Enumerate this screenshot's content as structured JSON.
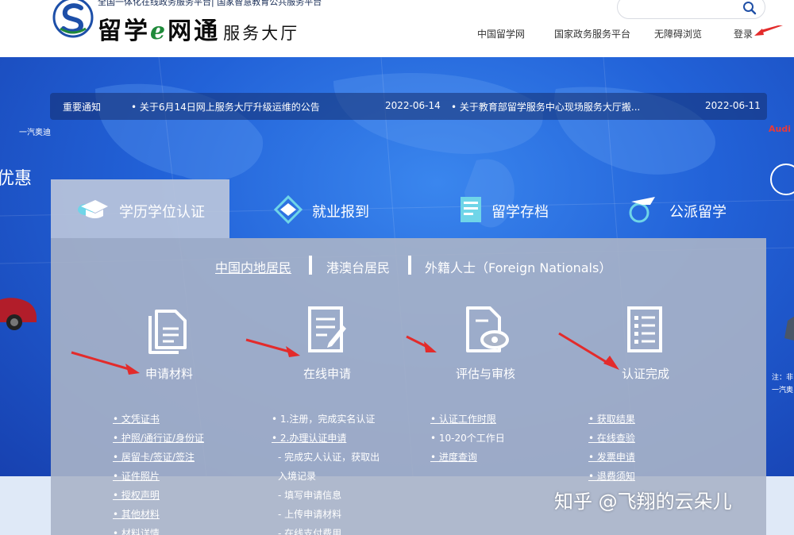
{
  "header": {
    "logo_top": "全国一体化在线政务服务平台| 国家智慧教育公共服务平台",
    "logo_brand": "留学e网通",
    "logo_sub": "服务大厅",
    "search_placeholder": "",
    "links": [
      "中国留学网",
      "国家政务服务平台",
      "无障碍浏览",
      "登录"
    ]
  },
  "notice": {
    "label": "重要通知",
    "items": [
      {
        "title": "• 关于6月14日网上服务大厅升级运维的公告",
        "date": "2022-06-14"
      },
      {
        "title": "• 关于教育部留学服务中心现场服务大厅搬...",
        "date": "2022-06-11"
      }
    ]
  },
  "banner_side": {
    "left_small": "一汽奥迪",
    "left_big": "优惠",
    "right_red": "Audi",
    "right_note_1": "注：非",
    "right_note_2": "一汽奥"
  },
  "tabs": [
    {
      "label": "学历学位认证",
      "icon": "graduation-cap-icon"
    },
    {
      "label": "就业报到",
      "icon": "handshake-icon"
    },
    {
      "label": "留学存档",
      "icon": "archive-icon"
    },
    {
      "label": "公派留学",
      "icon": "plane-globe-icon"
    }
  ],
  "citizen": [
    "中国内地居民",
    "港澳台居民",
    "外籍人士（Foreign Nationals）"
  ],
  "steps": [
    {
      "label": "申请材料",
      "icon": "documents-icon",
      "items": [
        "• 文凭证书",
        "• 护照/通行证/身份证",
        "• 居留卡/签证/签注",
        "• 证件照片",
        "• 授权声明",
        "• 其他材料",
        "• 材料详情"
      ]
    },
    {
      "label": "在线申请",
      "icon": "form-edit-icon",
      "items": [
        "• 1.注册，完成实名认证",
        "• 2.办理认证申请",
        "  - 完成实人认证，获取出",
        "入境记录",
        "  - 填写申请信息",
        "  - 上传申请材料",
        "  - 在线支付费用"
      ]
    },
    {
      "label": "评估与审核",
      "icon": "document-eye-icon",
      "items": [
        "• 认证工作时限",
        "• 10-20个工作日",
        "• 进度查询"
      ]
    },
    {
      "label": "认证完成",
      "icon": "checklist-icon",
      "items": [
        "• 获取结果",
        "• 在线查验",
        "• 发票申请",
        "• 退费须知"
      ]
    }
  ],
  "watermark": "知乎 @飞翔的云朵儿",
  "colors": {
    "banner": "#2262d8",
    "arrow": "#e32b2b",
    "panel": "#aab4c8"
  }
}
